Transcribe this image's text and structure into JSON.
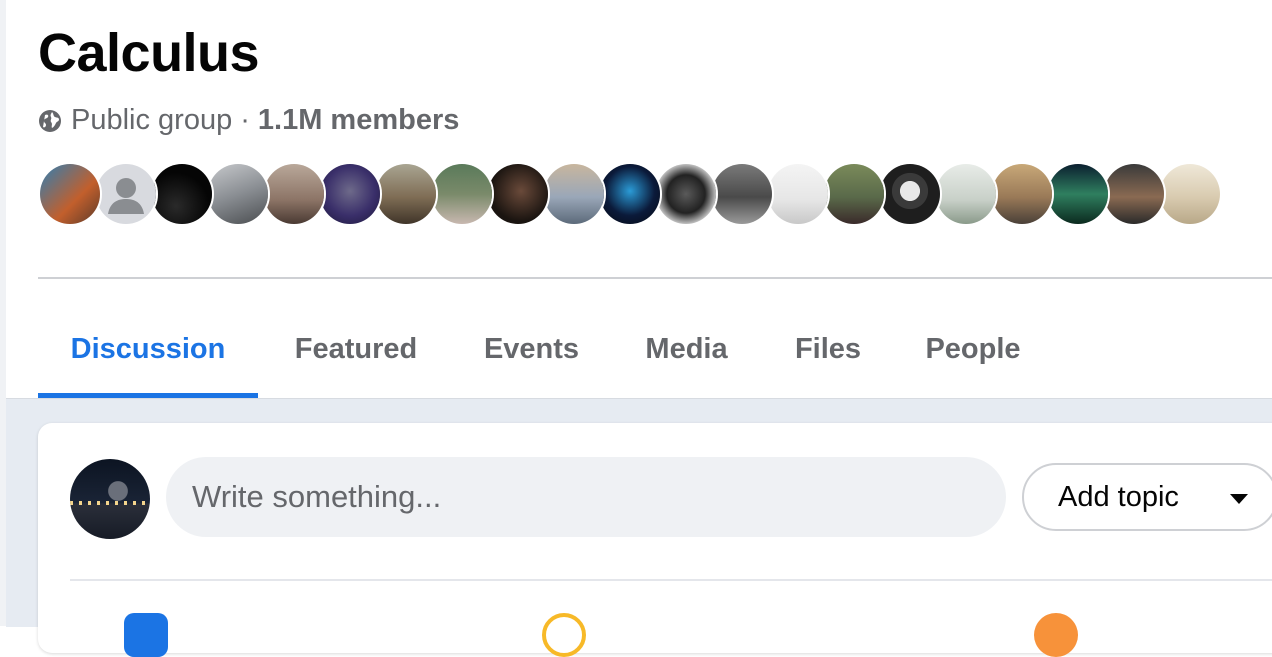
{
  "group": {
    "title": "Calculus",
    "privacy": "Public group",
    "separator": "·",
    "members_count": "1.1M members"
  },
  "member_avatars": [
    {
      "bg": "linear-gradient(135deg,#2f7fb4,#c25f2c 60%,#5b3a2a)"
    },
    {
      "bg": "#d8dadf",
      "placeholder": true
    },
    {
      "bg": "radial-gradient(circle at 40% 70%,#2a2a2a,#050505 60%)"
    },
    {
      "bg": "linear-gradient(160deg,#c7c9cc,#8a8e93 50%,#4a4d50)"
    },
    {
      "bg": "linear-gradient(180deg,#b9a89a,#8c7466 60%,#4a3a33)"
    },
    {
      "bg": "radial-gradient(circle at 50% 45%,#6e6a8a,#3a2f6a 55%,#1c173a)"
    },
    {
      "bg": "linear-gradient(180deg,#a9a592,#7f6d55 55%,#403529)"
    },
    {
      "bg": "linear-gradient(180deg,#5a7a5a,#7a8a6a 50%,#c8b8b0)"
    },
    {
      "bg": "radial-gradient(circle at 55% 45%,#6a4a3a,#1a1410 65%)"
    },
    {
      "bg": "linear-gradient(180deg,#c8b69e,#9aa7b8 55%,#5c6a7a)"
    },
    {
      "bg": "radial-gradient(circle at 50% 45%,#2b9bd6,#0b1a3a 55%,#05080f)"
    },
    {
      "bg": "radial-gradient(circle at 50% 50%,#5a5a5a,#222 45%,#bdbdbd 70%)"
    },
    {
      "bg": "linear-gradient(180deg,#7a7a7a,#4a4a4a 55%,#9a9a9a)"
    },
    {
      "bg": "linear-gradient(180deg,#f4f4f4,#e6e6e6 60%,#c8c8c8)"
    },
    {
      "bg": "linear-gradient(180deg,#7a8a5a,#5a6a4a 55%,#3a2a2a)"
    },
    {
      "bg": "radial-gradient(circle at 50% 45%,#e8e8e8 0 22%,#3a3a3a 23% 40%,#1e1e1e 41%)"
    },
    {
      "bg": "linear-gradient(180deg,#e8ece8,#c8d0c8 60%,#8a9a8a)"
    },
    {
      "bg": "linear-gradient(180deg,#c8a878,#9a7a58 55%,#4a4038)"
    },
    {
      "bg": "linear-gradient(180deg,#0b1f2f,#2f7f5f 50%,#0b2a1f)"
    },
    {
      "bg": "linear-gradient(180deg,#3a3a3a,#8a6a52 55%,#2a2a2a)"
    },
    {
      "bg": "linear-gradient(180deg,#efe8d8,#d9cbb0 55%,#b8a888)"
    }
  ],
  "tabs": [
    {
      "label": "Discussion",
      "active": true
    },
    {
      "label": "Featured",
      "active": false
    },
    {
      "label": "Events",
      "active": false
    },
    {
      "label": "Media",
      "active": false
    },
    {
      "label": "Files",
      "active": false
    },
    {
      "label": "People",
      "active": false
    }
  ],
  "composer": {
    "placeholder": "Write something...",
    "add_topic_label": "Add topic"
  },
  "colors": {
    "accent": "#1b74e4",
    "feed_bg": "#e6ebf2",
    "muted_text": "#65676b"
  }
}
